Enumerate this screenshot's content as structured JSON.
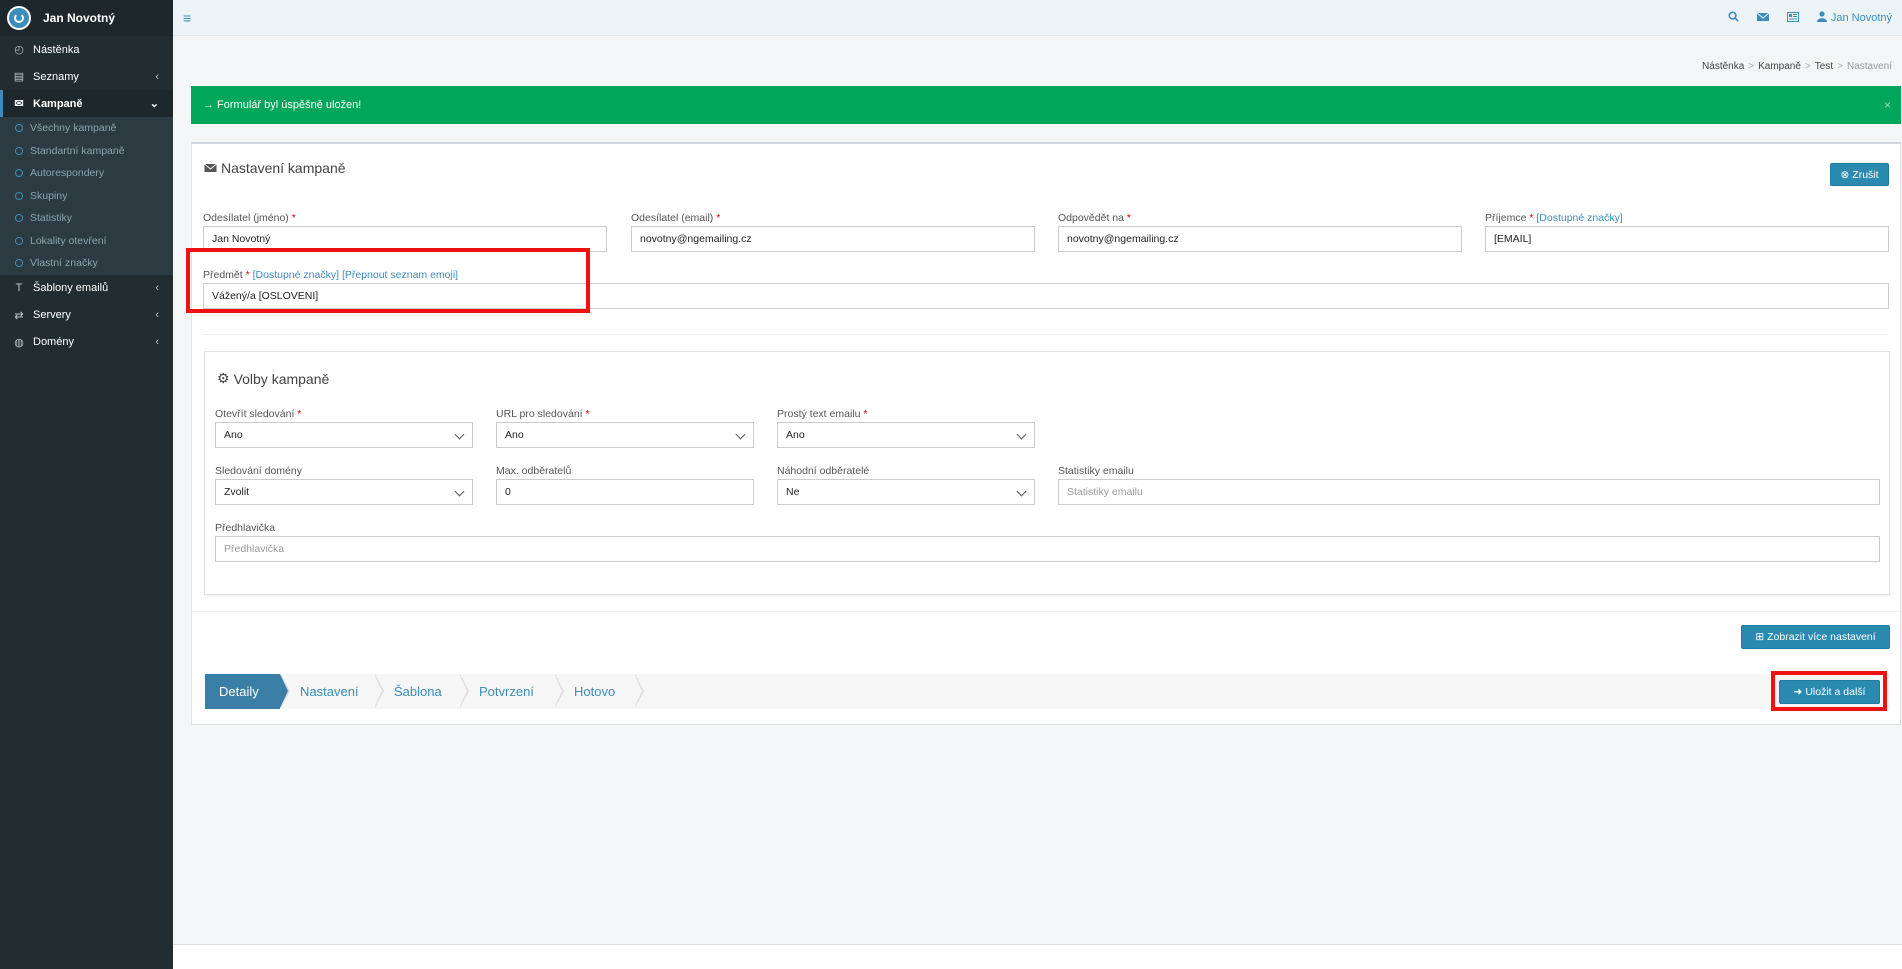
{
  "brand": {
    "user_name": "Jan Novotný"
  },
  "sidebar": {
    "items": [
      {
        "label": "Nástěnka",
        "icon": "dashboard-icon"
      },
      {
        "label": "Seznamy",
        "icon": "list-icon"
      },
      {
        "label": "Kampaně",
        "icon": "envelope-icon"
      },
      {
        "label": "Šablony emailů",
        "icon": "text-icon"
      },
      {
        "label": "Servery",
        "icon": "exchange-icon"
      },
      {
        "label": "Domény",
        "icon": "globe-icon"
      }
    ],
    "submenu": [
      "Všechny kampaně",
      "Standartní kampaně",
      "Autorespondery",
      "Skupiny",
      "Statistiky",
      "Lokality otevření",
      "Vlastní značky"
    ]
  },
  "topbar": {
    "user_name": "Jan Novotný"
  },
  "breadcrumb": {
    "items": [
      "Nástěnka",
      "Kampaně",
      "Test",
      "Nastavení"
    ],
    "separator": ">"
  },
  "alert": {
    "text": "→ Formulář byl úspěšně uložen!",
    "close": "×"
  },
  "form": {
    "title": "Nastavení kampaně",
    "cancel_label": "Zrušit",
    "sender_name": {
      "label": "Odesílatel (jméno)",
      "value": "Jan Novotný"
    },
    "sender_email": {
      "label": "Odesílatel (email)",
      "value": "novotny@ngemailing.cz"
    },
    "reply_to": {
      "label": "Odpovědět na",
      "value": "novotny@ngemailing.cz"
    },
    "recipient": {
      "label": "Příjemce",
      "link": "[Dostupné značky]",
      "value": "[EMAIL]"
    },
    "subject": {
      "label": "Předmět",
      "link1": "[Dostupné značky]",
      "link2": "[Přepnout seznam emoji]",
      "value": "Vážený/a [OSLOVENI]"
    },
    "required_mark": "*"
  },
  "options": {
    "title": "Volby kampaně",
    "open_tracking": {
      "label": "Otevřít sledování",
      "value": "Ano"
    },
    "url_tracking": {
      "label": "URL pro sledování",
      "value": "Ano"
    },
    "plain_text": {
      "label": "Prostý text emailu",
      "value": "Ano"
    },
    "domain_tracking": {
      "label": "Sledování domény",
      "value": "Zvolit"
    },
    "max_subscribers": {
      "label": "Max. odběratelů",
      "value": "0"
    },
    "random_subscribers": {
      "label": "Náhodní odběratelé",
      "value": "Ne"
    },
    "email_stats": {
      "label": "Statistiky emailu",
      "placeholder": "Statistiky emailu"
    },
    "preheader": {
      "label": "Předhlavička",
      "placeholder": "Předhlavička"
    }
  },
  "more_settings_label": "Zobrazit více nastavení",
  "wizard": {
    "steps": [
      "Detaily",
      "Nastavení",
      "Šablona",
      "Potvrzení",
      "Hotovo"
    ],
    "active": 0
  },
  "save_next_label": "Uložit a další",
  "colors": {
    "sidebar": "#222d32",
    "accent": "#3c8dbc",
    "success": "#00a65a",
    "button": "#2a8ab0",
    "highlight": "#ee1111"
  }
}
